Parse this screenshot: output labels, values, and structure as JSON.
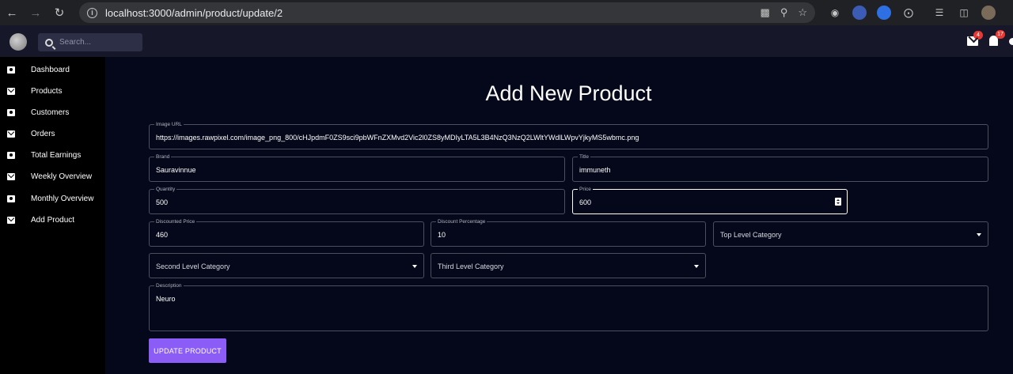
{
  "browser": {
    "url": "localhost:3000/admin/product/update/2",
    "icons": [
      "back-icon",
      "forward-icon",
      "reload-icon",
      "info-icon",
      "install-icon",
      "zoom-icon",
      "bookmark-star-icon",
      "camera-icon",
      "extension-icon",
      "extension-icon",
      "puzzle-icon",
      "media-icon",
      "sidebar-icon",
      "profile-avatar"
    ]
  },
  "header": {
    "search_placeholder": "Search...",
    "mail_badge": "4",
    "bell_badge": "17"
  },
  "sidebar": {
    "items": [
      {
        "label": "Dashboard",
        "icon": "tv-icon"
      },
      {
        "label": "Products",
        "icon": "mail-icon"
      },
      {
        "label": "Customers",
        "icon": "tv-icon"
      },
      {
        "label": "Orders",
        "icon": "mail-icon"
      },
      {
        "label": "Total Earnings",
        "icon": "tv-icon"
      },
      {
        "label": "Weekly Overview",
        "icon": "mail-icon"
      },
      {
        "label": "Monthly Overview",
        "icon": "tv-icon"
      },
      {
        "label": "Add Product",
        "icon": "mail-icon"
      }
    ]
  },
  "form": {
    "title": "Add New Product",
    "image_url": {
      "label": "Image URL",
      "value": "https://images.rawpixel.com/image_png_800/cHJpdmF0ZS9sci9pbWFnZXMvd2Vic2l0ZS8yMDIyLTA5L3B4NzQ3NzQ2LWltYWdlLWpvYjkyMS5wbmc.png"
    },
    "brand": {
      "label": "Brand",
      "value": "Sauravinnue"
    },
    "title_field": {
      "label": "Title",
      "value": "immuneth"
    },
    "quantity": {
      "label": "Quantity",
      "value": "500"
    },
    "price": {
      "label": "Price",
      "value": "600"
    },
    "discounted_price": {
      "label": "Discounted Price",
      "value": "460"
    },
    "discount_percentage": {
      "label": "Discount Percentage",
      "value": "10"
    },
    "top_category": {
      "label": "Top Level Category"
    },
    "second_category": {
      "label": "Second Level Category"
    },
    "third_category": {
      "label": "Third Level Category"
    },
    "description": {
      "label": "Description",
      "value": "Neuro"
    },
    "submit_label": "UPDATE PRODUCT"
  },
  "colors": {
    "accent": "#8b5cf6",
    "badge": "#e53935",
    "background": "#05081a"
  }
}
